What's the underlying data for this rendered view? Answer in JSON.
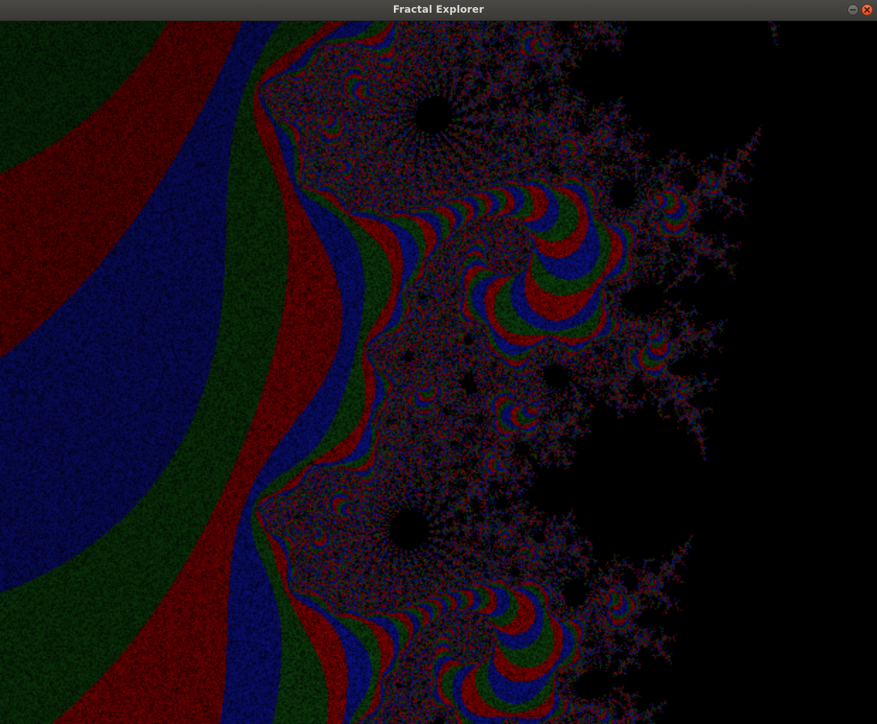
{
  "window": {
    "title": "Fractal Explorer"
  },
  "titlebar_buttons": {
    "minimize_icon": "minimize-icon",
    "close_icon": "close-icon",
    "close_color": "#e95420"
  },
  "palette": {
    "background": "#000000",
    "red": "#7a0000",
    "green": "#0b3a0b",
    "blue": "#0a0f78"
  }
}
